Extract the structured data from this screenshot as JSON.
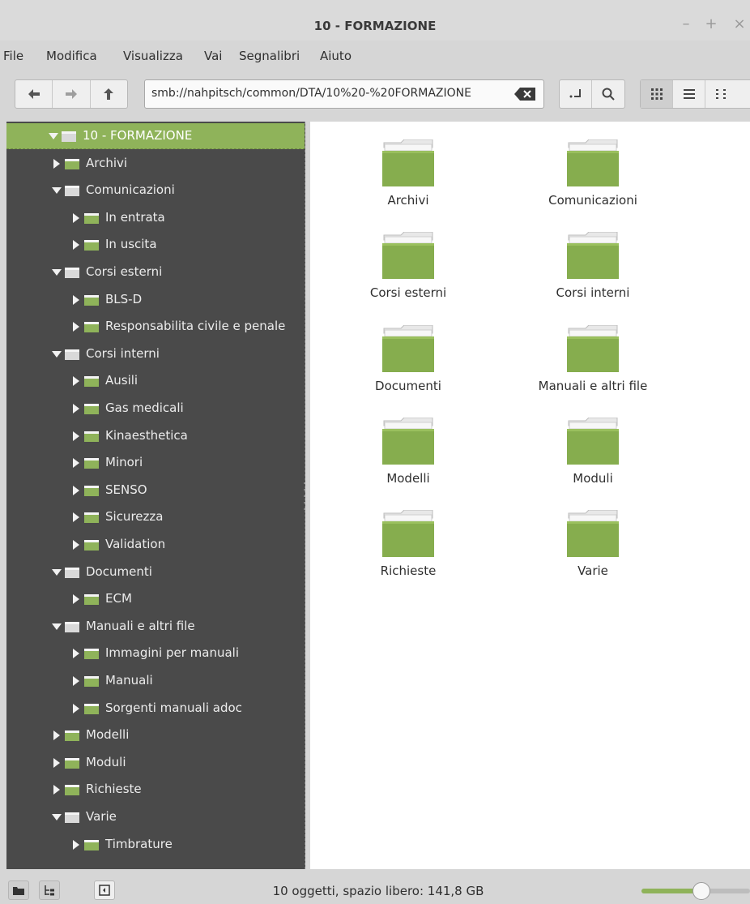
{
  "window": {
    "title": "10 - FORMAZIONE",
    "minimize": "–",
    "maximize": "+",
    "close": "×"
  },
  "menubar": [
    "File",
    "Modifica",
    "Visualizza",
    "Vai",
    "Segnalibri",
    "Aiuto"
  ],
  "location": {
    "path": "smb://nahpitsch/common/DTA/10%20-%20FORMAZIONE"
  },
  "sidebar": {
    "items": [
      {
        "label": "10 - FORMAZIONE",
        "level": 1,
        "expanded": true,
        "selected": true
      },
      {
        "label": "Archivi",
        "level": 2,
        "expanded": false
      },
      {
        "label": "Comunicazioni",
        "level": 2,
        "expanded": true
      },
      {
        "label": "In entrata",
        "level": 3,
        "expanded": false
      },
      {
        "label": "In uscita",
        "level": 3,
        "expanded": false
      },
      {
        "label": "Corsi esterni",
        "level": 2,
        "expanded": true
      },
      {
        "label": "BLS-D",
        "level": 3,
        "expanded": false
      },
      {
        "label": "Responsabilita civile e penale",
        "level": 3,
        "expanded": false
      },
      {
        "label": "Corsi interni",
        "level": 2,
        "expanded": true
      },
      {
        "label": "Ausili",
        "level": 3,
        "expanded": false
      },
      {
        "label": "Gas medicali",
        "level": 3,
        "expanded": false
      },
      {
        "label": "Kinaesthetica",
        "level": 3,
        "expanded": false
      },
      {
        "label": "Minori",
        "level": 3,
        "expanded": false
      },
      {
        "label": "SENSO",
        "level": 3,
        "expanded": false
      },
      {
        "label": "Sicurezza",
        "level": 3,
        "expanded": false
      },
      {
        "label": "Validation",
        "level": 3,
        "expanded": false
      },
      {
        "label": "Documenti",
        "level": 2,
        "expanded": true
      },
      {
        "label": "ECM",
        "level": 3,
        "expanded": false
      },
      {
        "label": "Manuali e altri file",
        "level": 2,
        "expanded": true
      },
      {
        "label": "Immagini per manuali",
        "level": 3,
        "expanded": false
      },
      {
        "label": "Manuali",
        "level": 3,
        "expanded": false
      },
      {
        "label": "Sorgenti manuali adoc",
        "level": 3,
        "expanded": false
      },
      {
        "label": "Modelli",
        "level": 2,
        "expanded": false
      },
      {
        "label": "Moduli",
        "level": 2,
        "expanded": false
      },
      {
        "label": "Richieste",
        "level": 2,
        "expanded": false
      },
      {
        "label": "Varie",
        "level": 2,
        "expanded": true
      },
      {
        "label": "Timbrature",
        "level": 3,
        "expanded": false
      }
    ]
  },
  "main": {
    "folders": [
      "Archivi",
      "Comunicazioni",
      "Corsi esterni",
      "Corsi interni",
      "Documenti",
      "Manuali e altri file",
      "Modelli",
      "Moduli",
      "Richieste",
      "Varie"
    ]
  },
  "statusbar": {
    "text": "10 oggetti, spazio libero: 141,8 GB",
    "zoom_level": 0.55
  },
  "colors": {
    "accent": "#8fb35a",
    "folder_green": "#86ad4e",
    "sidebar_bg": "#4a4a4a"
  },
  "icons": {
    "nav": [
      "back-arrow-icon",
      "forward-arrow-icon",
      "up-arrow-icon"
    ],
    "toolbar": [
      "toggle-location-icon",
      "search-icon",
      "icon-view-icon",
      "list-view-icon",
      "compact-view-icon"
    ],
    "statusbar": [
      "places-icon",
      "tree-icon",
      "hide-sidebar-icon"
    ]
  }
}
